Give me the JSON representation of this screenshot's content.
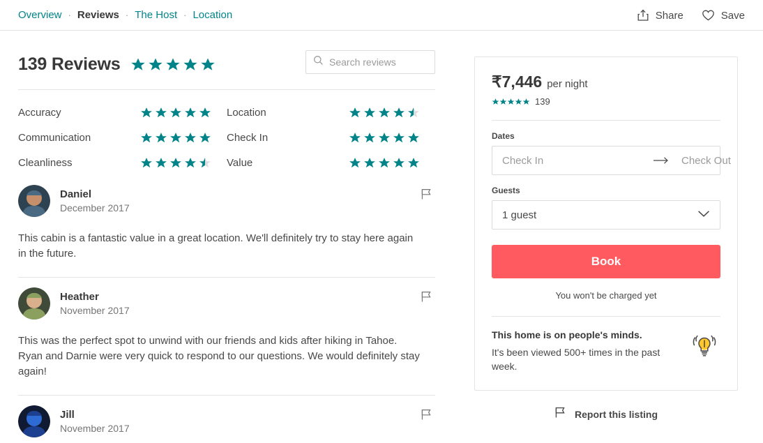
{
  "nav": {
    "items": [
      {
        "label": "Overview",
        "active": false
      },
      {
        "label": "Reviews",
        "active": true
      },
      {
        "label": "The Host",
        "active": false
      },
      {
        "label": "Location",
        "active": false
      }
    ],
    "separator": "·",
    "share_label": "Share",
    "save_label": "Save",
    "share_icon": "share-icon",
    "save_icon": "heart-icon"
  },
  "reviews_header": {
    "title": "139 Reviews",
    "overall_stars": 5,
    "search_placeholder": "Search reviews",
    "search_value": "",
    "search_icon": "search-icon"
  },
  "ratings": [
    {
      "label": "Accuracy",
      "stars": 5
    },
    {
      "label": "Location",
      "stars": 4.5
    },
    {
      "label": "Communication",
      "stars": 5
    },
    {
      "label": "Check In",
      "stars": 5
    },
    {
      "label": "Cleanliness",
      "stars": 4.5
    },
    {
      "label": "Value",
      "stars": 5
    }
  ],
  "reviews": [
    {
      "name": "Daniel",
      "date": "December 2017",
      "text": "This cabin is a fantastic value in a great location. We'll definitely try to stay here again in the future.",
      "avatar_colors": [
        "#4a6a84",
        "#c48f6a",
        "#2e4352"
      ]
    },
    {
      "name": "Heather",
      "date": "November 2017",
      "text": "This was the perfect spot to unwind with our friends and kids after hiking in Tahoe. Ryan and Darnie were very quick to respond to our questions. We would definitely stay again!",
      "avatar_colors": [
        "#8ba05f",
        "#d9b08c",
        "#3f4a38"
      ]
    },
    {
      "name": "Jill",
      "date": "November 2017",
      "text": "",
      "avatar_colors": [
        "#1c3f8f",
        "#2e6bd4",
        "#101a33"
      ]
    }
  ],
  "booking": {
    "price": "₹7,446",
    "per_night": "per night",
    "rating_stars": 5,
    "rating_count": "139",
    "dates_label": "Dates",
    "checkin_placeholder": "Check In",
    "checkout_placeholder": "Check Out",
    "checkin_value": "",
    "checkout_value": "",
    "guests_label": "Guests",
    "guests_value": "1 guest",
    "book_label": "Book",
    "charge_note": "You won't be charged yet",
    "minds_title": "This home is on people's minds.",
    "minds_sub": "It's been viewed 500+ times in the past week.",
    "bulb_icon": "lightbulb-icon",
    "report_label": "Report this listing",
    "report_icon": "flag-icon",
    "book_color": "#FF5A5F",
    "star_color": "#008489"
  },
  "review_flag_icon": "flag-icon"
}
